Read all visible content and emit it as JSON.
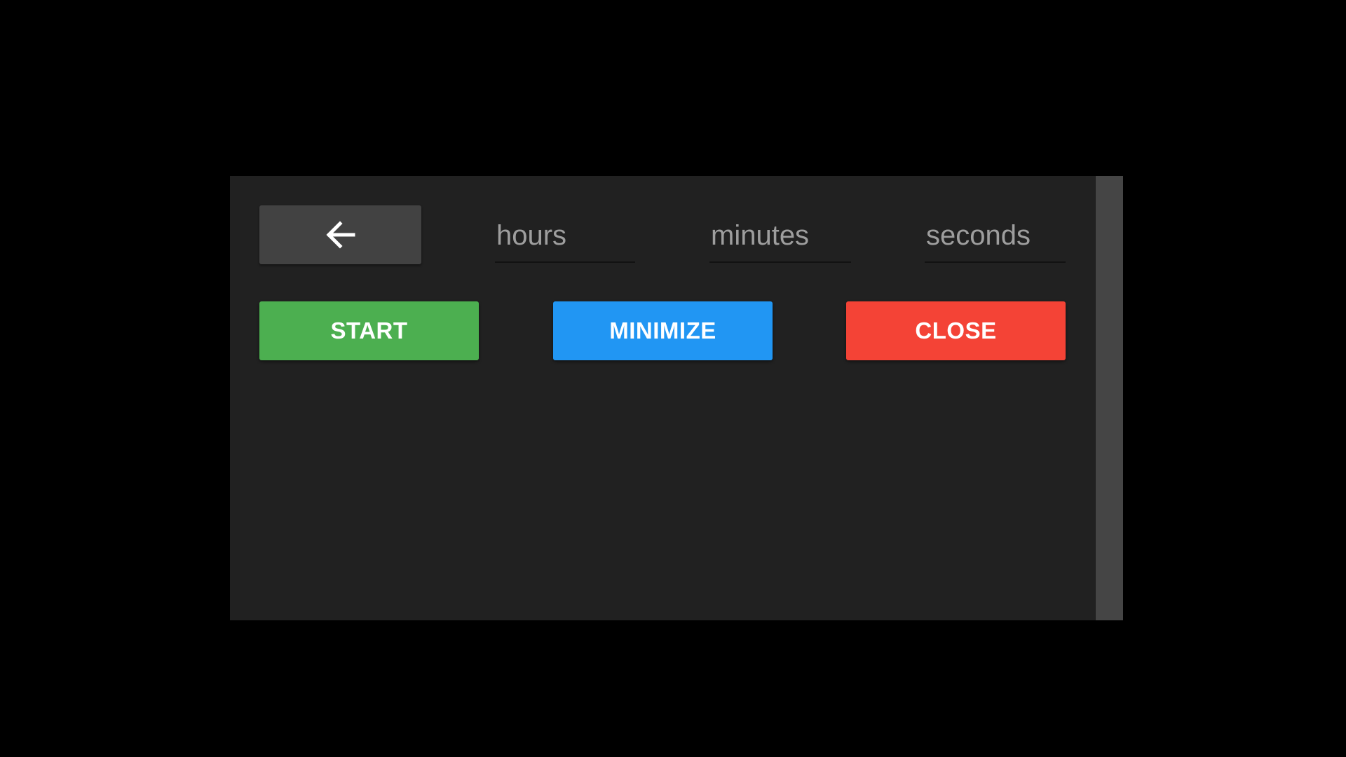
{
  "colors": {
    "page_background": "#000000",
    "window_background": "#212121",
    "scrollbar": "#454545",
    "back_button": "#424242",
    "start": "#4caf50",
    "minimize": "#2196f3",
    "close": "#f44336"
  },
  "back_button": {
    "icon": "arrow-left-icon"
  },
  "fields": {
    "hours": {
      "placeholder": "hours",
      "value": ""
    },
    "minutes": {
      "placeholder": "minutes",
      "value": ""
    },
    "seconds": {
      "placeholder": "seconds",
      "value": ""
    }
  },
  "buttons": {
    "start": "START",
    "minimize": "MINIMIZE",
    "close": "CLOSE"
  }
}
